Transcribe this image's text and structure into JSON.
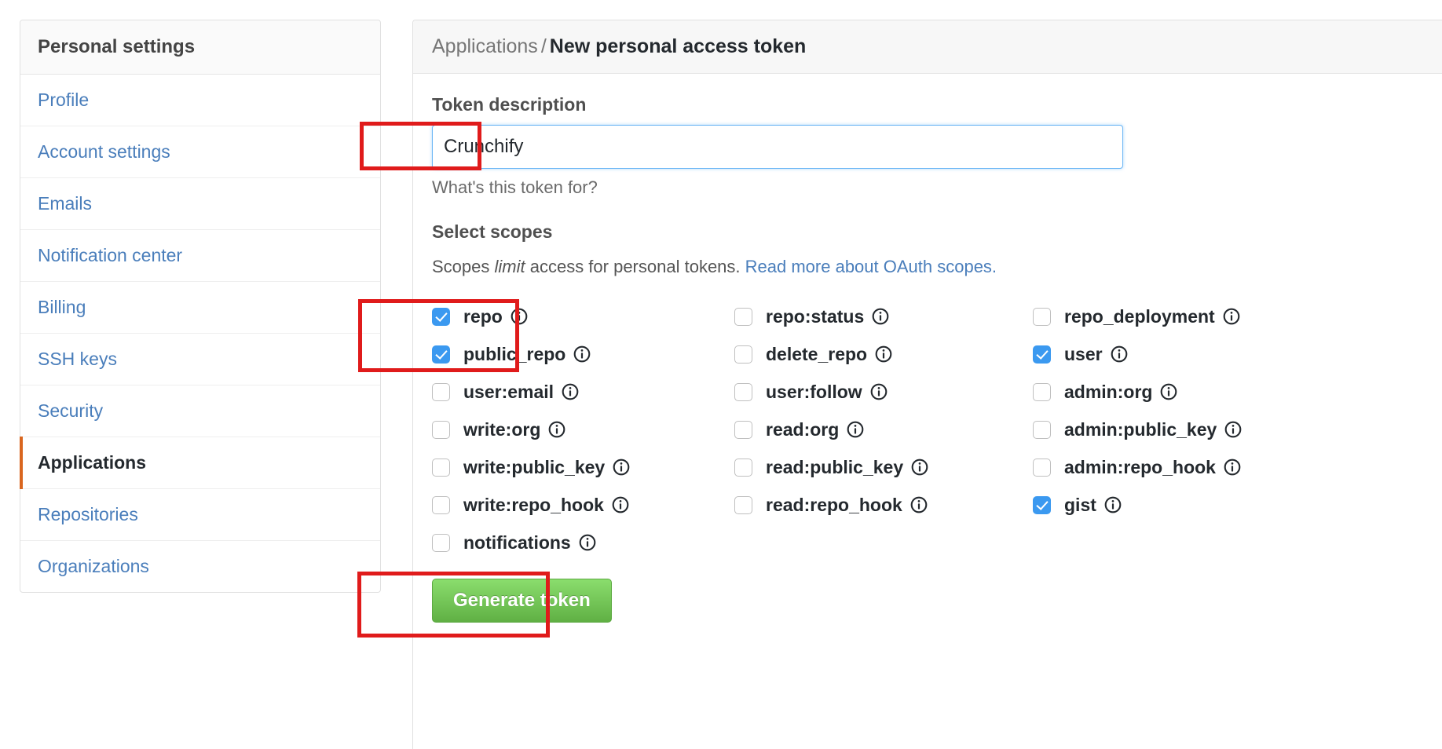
{
  "sidebar": {
    "header": "Personal settings",
    "items": [
      {
        "label": "Profile",
        "selected": false
      },
      {
        "label": "Account settings",
        "selected": false
      },
      {
        "label": "Emails",
        "selected": false
      },
      {
        "label": "Notification center",
        "selected": false
      },
      {
        "label": "Billing",
        "selected": false
      },
      {
        "label": "SSH keys",
        "selected": false
      },
      {
        "label": "Security",
        "selected": false
      },
      {
        "label": "Applications",
        "selected": true
      },
      {
        "label": "Repositories",
        "selected": false
      },
      {
        "label": "Organizations",
        "selected": false
      }
    ]
  },
  "main": {
    "breadcrumb": {
      "parent": "Applications",
      "separator": "/",
      "current": "New personal access token"
    },
    "token_description": {
      "label": "Token description",
      "value": "Crunchify",
      "placeholder": "",
      "help": "What's this token for?"
    },
    "scopes_section": {
      "title": "Select scopes",
      "description_prefix": "Scopes ",
      "description_emphasis": "limit",
      "description_middle": " access for personal tokens. ",
      "link_text": "Read more about OAuth scopes."
    },
    "scopes": [
      {
        "name": "repo",
        "checked": true,
        "info": "info-icon"
      },
      {
        "name": "repo:status",
        "checked": false,
        "info": "info-icon"
      },
      {
        "name": "repo_deployment",
        "checked": false,
        "info": "info-icon"
      },
      {
        "name": "public_repo",
        "checked": true,
        "info": "info-icon"
      },
      {
        "name": "delete_repo",
        "checked": false,
        "info": "info-icon"
      },
      {
        "name": "user",
        "checked": true,
        "info": "info-icon"
      },
      {
        "name": "user:email",
        "checked": false,
        "info": "info-icon"
      },
      {
        "name": "user:follow",
        "checked": false,
        "info": "info-icon"
      },
      {
        "name": "admin:org",
        "checked": false,
        "info": "info-icon"
      },
      {
        "name": "write:org",
        "checked": false,
        "info": "info-icon"
      },
      {
        "name": "read:org",
        "checked": false,
        "info": "info-icon"
      },
      {
        "name": "admin:public_key",
        "checked": false,
        "info": "info-icon"
      },
      {
        "name": "write:public_key",
        "checked": false,
        "info": "info-icon"
      },
      {
        "name": "read:public_key",
        "checked": false,
        "info": "info-icon"
      },
      {
        "name": "admin:repo_hook",
        "checked": false,
        "info": "info-icon"
      },
      {
        "name": "write:repo_hook",
        "checked": false,
        "info": "info-icon"
      },
      {
        "name": "read:repo_hook",
        "checked": false,
        "info": "info-icon"
      },
      {
        "name": "gist",
        "checked": true,
        "info": "info-icon"
      },
      {
        "name": "notifications",
        "checked": false,
        "info": "info-icon"
      },
      {
        "name": "",
        "checked": false,
        "info": ""
      },
      {
        "name": "",
        "checked": false,
        "info": ""
      }
    ],
    "generate_button": "Generate token"
  },
  "annotations": [
    {
      "name": "token-description-highlight"
    },
    {
      "name": "repo-scopes-highlight"
    },
    {
      "name": "generate-token-highlight"
    }
  ],
  "colors": {
    "link": "#4a7ebb",
    "checkbox_checked": "#3b99f0",
    "button_green": "#60b044",
    "annotation_red": "#e01b1b",
    "selected_accent": "#d9661f"
  }
}
